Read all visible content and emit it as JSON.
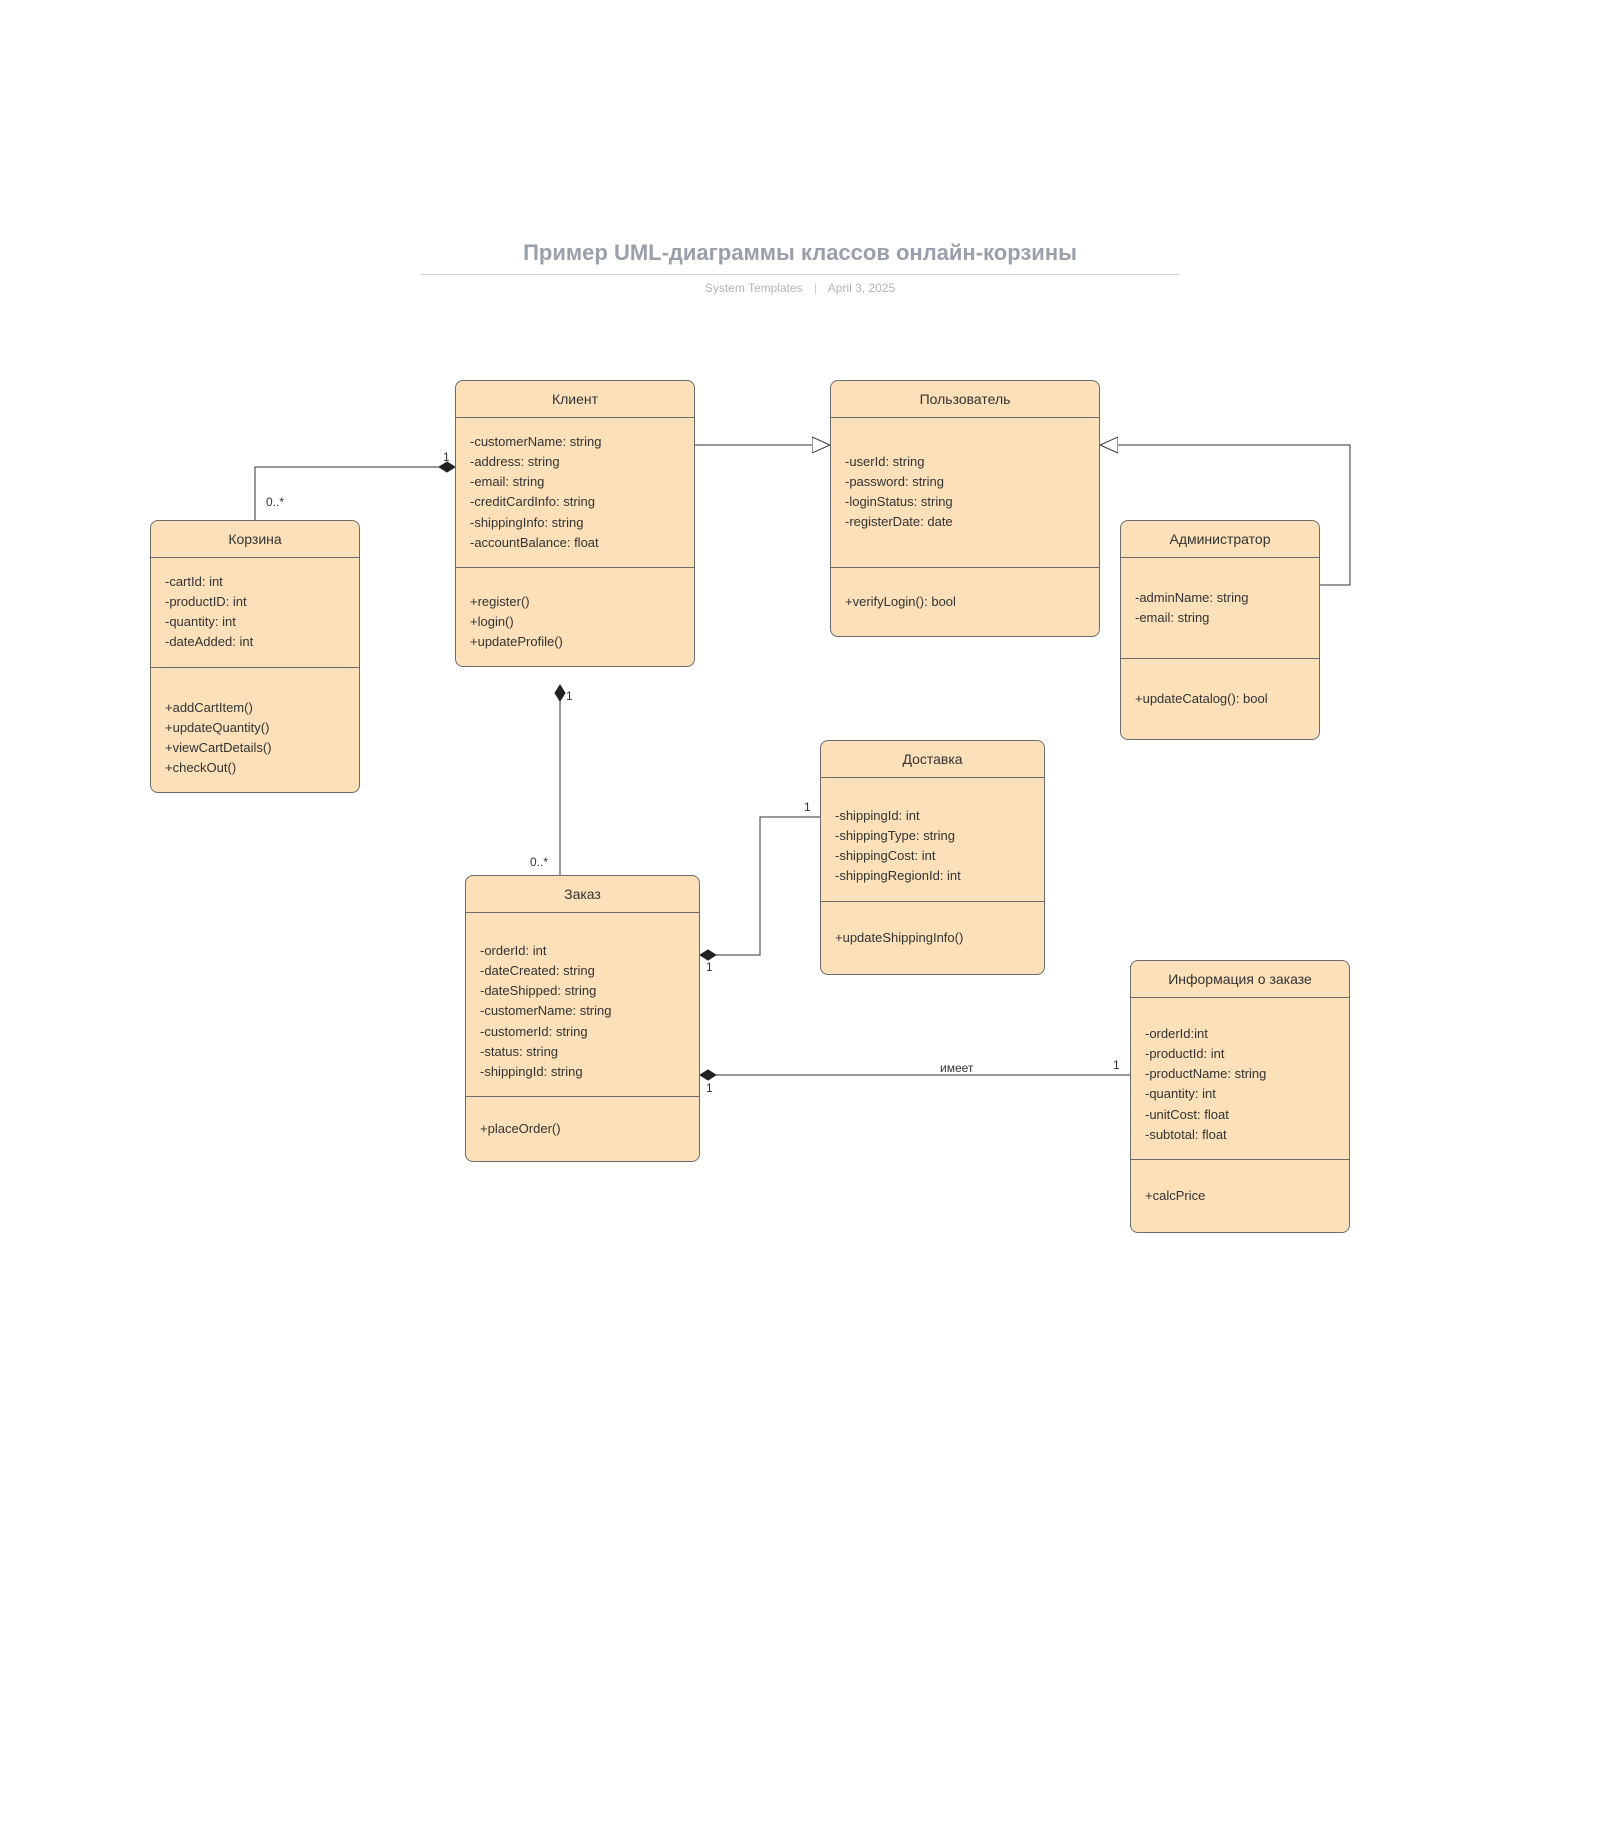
{
  "header": {
    "title": "Пример UML-диаграммы классов онлайн-корзины",
    "subtitle_left": "System Templates",
    "subtitle_right": "April 3, 2025"
  },
  "classes": {
    "cart": {
      "name": "Корзина",
      "attrs": [
        "-cartId: int",
        "-productID: int",
        "-quantity: int",
        "-dateAdded: int"
      ],
      "ops": [
        "+addCartItem()",
        "+updateQuantity()",
        "+viewCartDetails()",
        "+checkOut()"
      ]
    },
    "client": {
      "name": "Клиент",
      "attrs": [
        "-customerName: string",
        "-address: string",
        "-email: string",
        "-creditCardInfo: string",
        "-shippingInfo: string",
        "-accountBalance: float"
      ],
      "ops": [
        "+register()",
        "+login()",
        "+updateProfile()"
      ]
    },
    "user": {
      "name": "Пользователь",
      "attrs": [
        "-userId: string",
        "-password: string",
        "-loginStatus: string",
        "-registerDate: date"
      ],
      "ops": [
        "+verifyLogin(): bool"
      ]
    },
    "admin": {
      "name": "Администратор",
      "attrs": [
        "-adminName: string",
        "-email: string"
      ],
      "ops": [
        "+updateCatalog(): bool"
      ]
    },
    "order": {
      "name": "Заказ",
      "attrs": [
        "-orderId: int",
        "-dateCreated: string",
        "-dateShipped: string",
        "-customerName: string",
        "-customerId: string",
        "-status: string",
        "-shippingId: string"
      ],
      "ops": [
        "+placeOrder()"
      ]
    },
    "shipping": {
      "name": "Доставка",
      "attrs": [
        "-shippingId: int",
        "-shippingType: string",
        "-shippingCost: int",
        "-shippingRegionId: int"
      ],
      "ops": [
        "+updateShippingInfo()"
      ]
    },
    "orderInfo": {
      "name": "Информация о заказе",
      "attrs": [
        "-orderId:int",
        "-productId: int",
        "-productName: string",
        "-quantity: int",
        "-unitCost: float",
        "-subtotal: float"
      ],
      "ops": [
        "+calcPrice"
      ]
    }
  },
  "labels": {
    "zeroStar1": "0..*",
    "one_a": "1",
    "one_b": "1",
    "zeroStar2": "0..*",
    "one_c": "1",
    "one_d": "1",
    "one_e": "1",
    "one_f": "1",
    "has": "имеет"
  }
}
